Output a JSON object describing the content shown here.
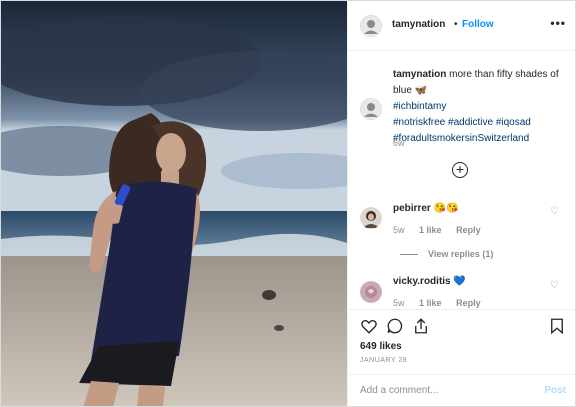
{
  "post": {
    "username": "tamynation",
    "dot": "•",
    "follow_label": "Follow",
    "more_label": "•••"
  },
  "caption": {
    "username": "tamynation",
    "text": "more than fifty shades of blue",
    "butterfly": "🦋",
    "tags": [
      "#ichbintamy",
      "#notriskfree #addictive #iqosad",
      "#foradultsmokersinSwitzerland"
    ],
    "time": "6w"
  },
  "comments": [
    {
      "username": "pebirrer",
      "emoji": "😘😘",
      "time": "5w",
      "likes": "1 like",
      "reply": "Reply",
      "view_replies": "View replies (1)"
    },
    {
      "username": "vicky.roditis",
      "emoji": "💙",
      "time": "5w",
      "likes": "1 like",
      "reply": "Reply"
    }
  ],
  "likes_count": "649 likes",
  "date": "JANUARY 28",
  "comment_box": {
    "placeholder": "Add a comment...",
    "post_label": "Post"
  },
  "icons": [
    "more-icon",
    "add-icon",
    "heart-icon",
    "comment-icon",
    "share-icon",
    "bookmark-icon"
  ],
  "colors": {
    "link_blue": "#0095f6",
    "disabled_post": "#b2dffc",
    "secondary_text": "#8e8e8e"
  }
}
